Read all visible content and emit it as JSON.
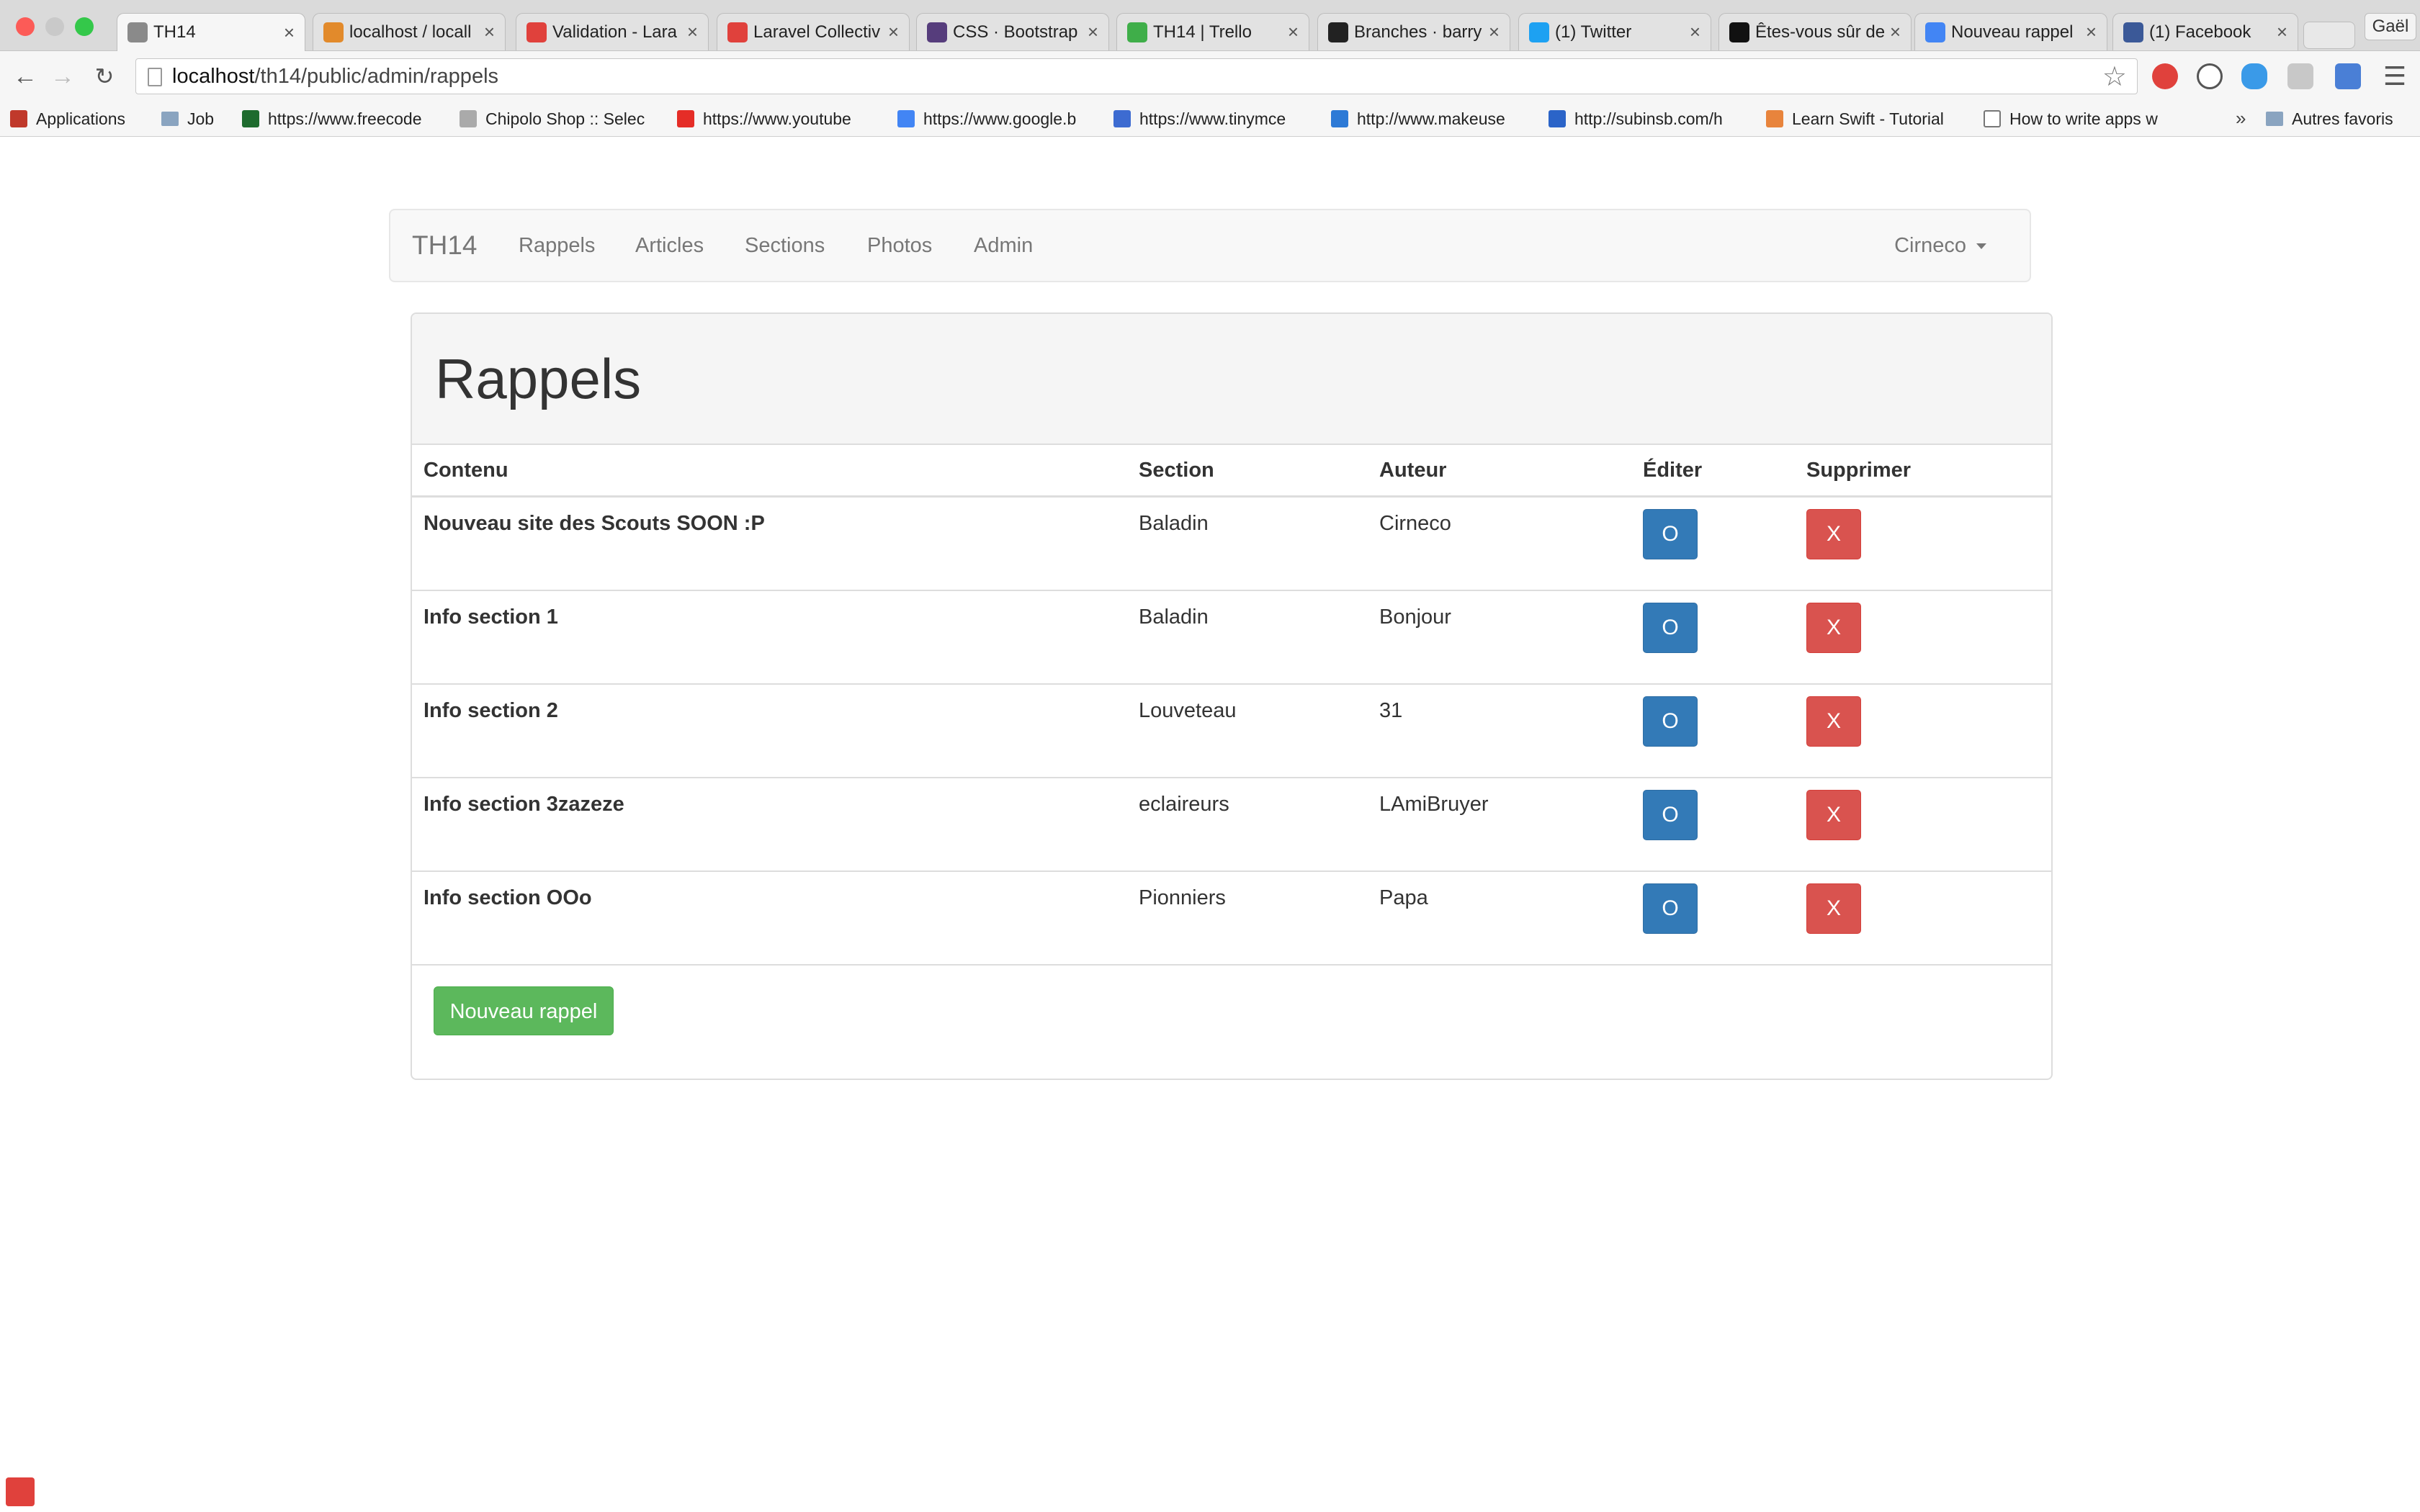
{
  "browser": {
    "tabs": [
      {
        "title": "TH14",
        "favicon": "globe-icon",
        "color": "#8a8a8a"
      },
      {
        "title": "localhost / locall",
        "favicon": "phpmyadmin-icon",
        "color": "#e28a2b"
      },
      {
        "title": "Validation - Lara",
        "favicon": "laravel-icon",
        "color": "#e0413c"
      },
      {
        "title": "Laravel Collectiv",
        "favicon": "laravel-collective-icon",
        "color": "#e0413c"
      },
      {
        "title": "CSS · Bootstrap",
        "favicon": "bootstrap-icon",
        "color": "#563d7c"
      },
      {
        "title": "TH14 | Trello",
        "favicon": "trello-icon",
        "color": "#3fae49"
      },
      {
        "title": "Branches · barry",
        "favicon": "github-icon",
        "color": "#222222"
      },
      {
        "title": "(1) Twitter",
        "favicon": "twitter-icon",
        "color": "#1da1f2"
      },
      {
        "title": "Êtes-vous sûr de",
        "favicon": "medium-icon",
        "color": "#111111"
      },
      {
        "title": "Nouveau rappel",
        "favicon": "google-icon",
        "color": "#4285f4"
      },
      {
        "title": "(1) Facebook",
        "favicon": "facebook-icon",
        "color": "#3b5998"
      }
    ],
    "profile_name": "Gaël",
    "url_host": "localhost",
    "url_path": "/th14/public/admin/rappels",
    "bookmarks": [
      {
        "label": "Applications",
        "icon": "apps-grid-icon"
      },
      {
        "label": "Job",
        "icon": "folder-icon"
      },
      {
        "label": "https://www.freecode",
        "icon": "freecodecamp-icon"
      },
      {
        "label": "Chipolo Shop :: Selec",
        "icon": "chipolo-icon"
      },
      {
        "label": "https://www.youtube",
        "icon": "youtube-icon"
      },
      {
        "label": "https://www.google.b",
        "icon": "google-icon"
      },
      {
        "label": "https://www.tinymce",
        "icon": "tinymce-icon"
      },
      {
        "label": "http://www.makeuse",
        "icon": "makeuseof-icon"
      },
      {
        "label": "http://subinsb.com/h",
        "icon": "subinsb-icon"
      },
      {
        "label": "Learn Swift - Tutorial",
        "icon": "learnswift-icon"
      },
      {
        "label": "How to write apps w",
        "icon": "document-icon"
      }
    ],
    "bookmarks_overflow": "»",
    "other_bookmarks": "Autres favoris"
  },
  "navbar": {
    "brand": "TH14",
    "links": [
      "Rappels",
      "Articles",
      "Sections",
      "Photos",
      "Admin"
    ],
    "user": "Cirneco"
  },
  "panel": {
    "title": "Rappels",
    "columns": {
      "content": "Contenu",
      "section": "Section",
      "author": "Auteur",
      "edit": "Éditer",
      "delete": "Supprimer"
    },
    "rows": [
      {
        "content": "Nouveau site des Scouts SOON :P",
        "section": "Baladin",
        "author": "Cirneco"
      },
      {
        "content": "Info section 1",
        "section": "Baladin",
        "author": "Bonjour"
      },
      {
        "content": "Info section 2",
        "section": "Louveteau",
        "author": "31"
      },
      {
        "content": "Info section 3zazeze",
        "section": "eclaireurs",
        "author": "LAmiBruyer"
      },
      {
        "content": "Info section OOo",
        "section": "Pionniers",
        "author": "Papa"
      }
    ],
    "edit_label": "O",
    "delete_label": "X",
    "new_button": "Nouveau rappel"
  },
  "colors": {
    "primary": "#337ab7",
    "danger": "#d9534f",
    "success": "#5cb85c"
  }
}
